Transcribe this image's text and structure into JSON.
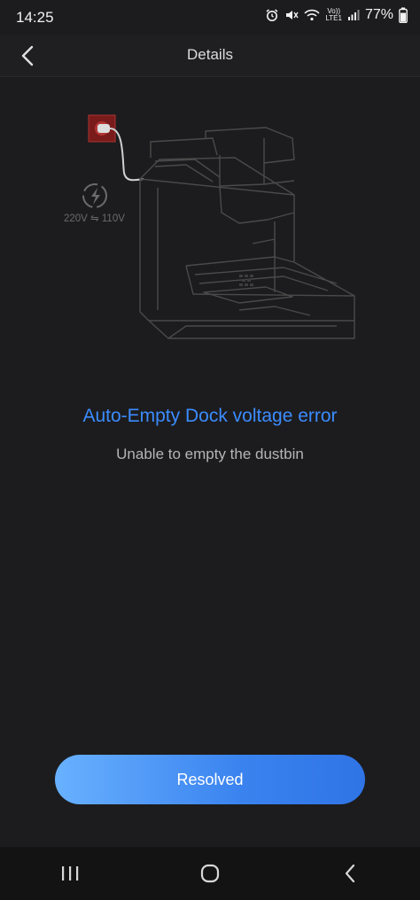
{
  "status_bar": {
    "time": "14:25",
    "battery": "77%",
    "network_top": "Vo))",
    "network_bottom": "LTE1",
    "icons": [
      "alarm-icon",
      "mute-icon",
      "wifi-icon",
      "signal-icon",
      "battery-icon"
    ]
  },
  "header": {
    "title": "Details",
    "back_icon": "chevron-left-icon"
  },
  "illustration": {
    "voltage_label": "220V ⇋ 110V",
    "icons": [
      "power-socket-icon",
      "voltage-warning-icon",
      "auto-empty-dock-illustration"
    ],
    "socket_color": "#7a1b1b"
  },
  "error": {
    "title": "Auto-Empty Dock voltage error",
    "subtitle": "Unable to empty the dustbin",
    "title_color": "#3b8cff"
  },
  "actions": {
    "resolved_label": "Resolved",
    "button_gradient": [
      "#68b1ff",
      "#2f74e6"
    ]
  },
  "system_nav": {
    "icons": [
      "recent-apps-icon",
      "home-icon",
      "back-icon"
    ]
  }
}
